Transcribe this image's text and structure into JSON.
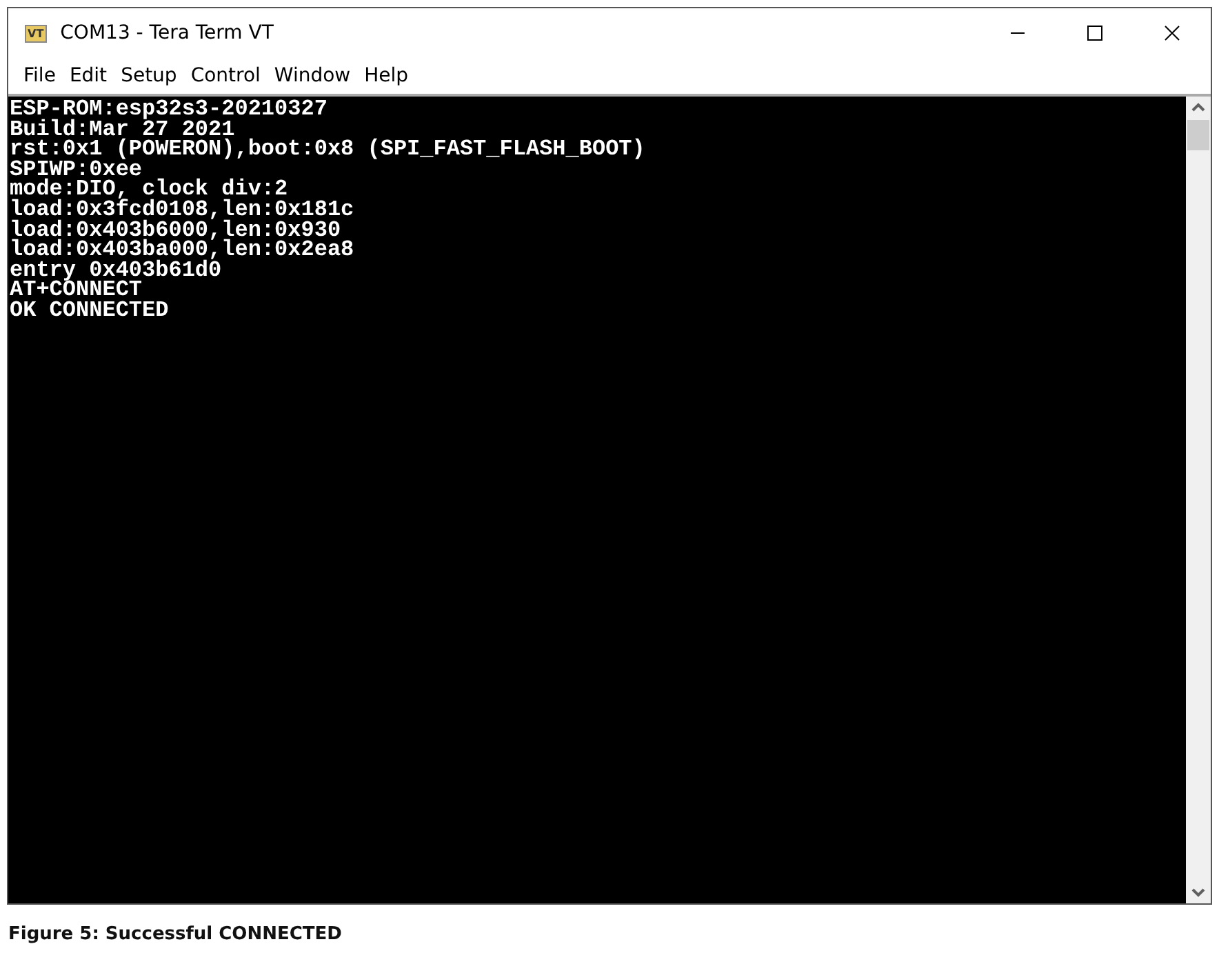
{
  "window": {
    "title": "COM13 - Tera Term VT",
    "app_icon_text": "VT"
  },
  "menu": [
    "File",
    "Edit",
    "Setup",
    "Control",
    "Window",
    "Help"
  ],
  "terminal": {
    "lines": [
      "ESP-ROM:esp32s3-20210327",
      "Build:Mar 27 2021",
      "rst:0x1 (POWERON),boot:0x8 (SPI_FAST_FLASH_BOOT)",
      "SPIWP:0xee",
      "mode:DIO, clock div:2",
      "load:0x3fcd0108,len:0x181c",
      "load:0x403b6000,len:0x930",
      "load:0x403ba000,len:0x2ea8",
      "entry 0x403b61d0",
      "AT+CONNECT",
      "OK CONNECTED"
    ]
  },
  "caption": "Figure 5: Successful CONNECTED"
}
